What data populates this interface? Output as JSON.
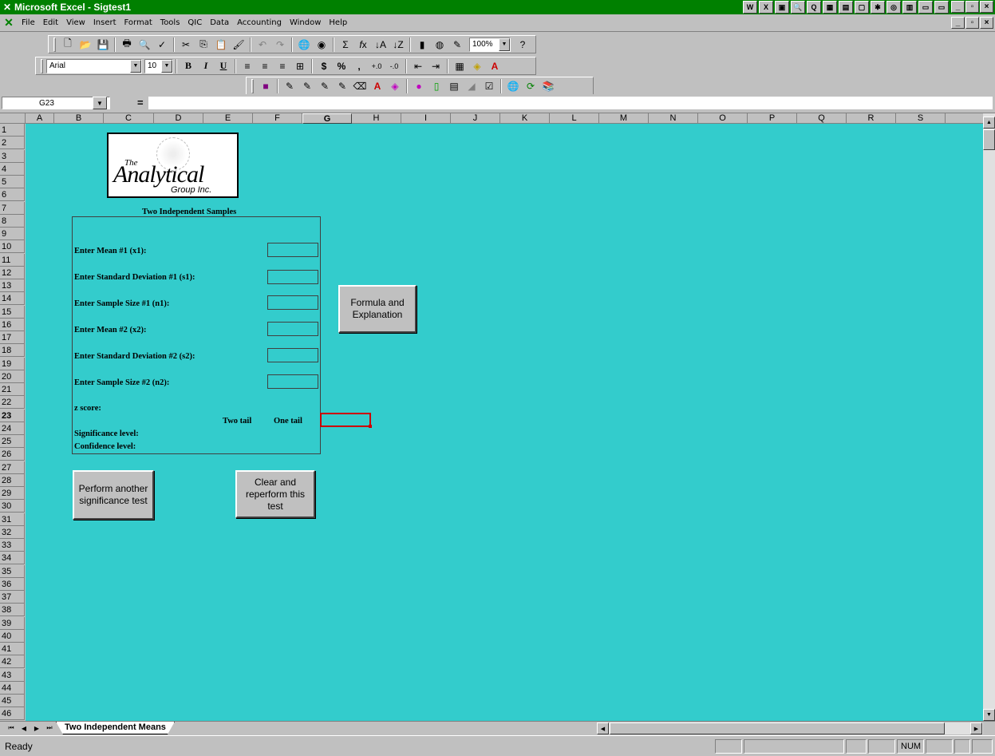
{
  "window": {
    "title": "Microsoft Excel - Sigtest1",
    "title_icons": [
      "W",
      "X",
      "▣",
      "🔍",
      "Q",
      "▦",
      "▤",
      "▢",
      "✱",
      "◎",
      "▥",
      "▭",
      "▭"
    ],
    "controls": {
      "minimize": "_",
      "maximize": "▫",
      "close": "×"
    }
  },
  "menu": {
    "items": [
      "File",
      "Edit",
      "View",
      "Insert",
      "Format",
      "Tools",
      "QIC",
      "Data",
      "Accounting",
      "Window",
      "Help"
    ]
  },
  "toolbar": {
    "zoom": "100%",
    "font_name": "Arial",
    "font_size": "10",
    "bold": "B",
    "italic": "I",
    "underline": "U",
    "currency": "$",
    "percent": "%",
    "comma": ","
  },
  "formula_bar": {
    "cell_ref": "G23",
    "equals": "=",
    "value": ""
  },
  "columns": [
    "A",
    "B",
    "C",
    "D",
    "E",
    "F",
    "G",
    "H",
    "I",
    "J",
    "K",
    "L",
    "M",
    "N",
    "O",
    "P",
    "Q",
    "R",
    "S"
  ],
  "selected_column": "G",
  "selected_row": "23",
  "logo": {
    "the": "The",
    "main": "Analytical",
    "sub": "Group Inc."
  },
  "panel": {
    "title": "Two Independent Samples",
    "mean1": "Enter Mean #1 (x1):",
    "sd1": "Enter Standard Deviation #1 (s1):",
    "n1": "Enter Sample Size #1 (n1):",
    "mean2": "Enter Mean #2 (x2):",
    "sd2": "Enter Standard Deviation #2 (s2):",
    "n2": "Enter Sample Size #2 (n2):",
    "zscore": "z score:",
    "two_tail": "Two tail",
    "one_tail": "One tail",
    "significance": "Significance level:",
    "confidence": "Confidence level:"
  },
  "buttons": {
    "formula": "Formula and Explanation",
    "perform_another": "Perform another significance test",
    "clear": "Clear and reperform this test"
  },
  "sheet_tab": "Two Independent Means",
  "status": {
    "ready": "Ready",
    "num": "NUM"
  },
  "colors": {
    "title_bar": "#008000",
    "sheet_bg": "#33cccc",
    "selection": "#cc0000"
  }
}
